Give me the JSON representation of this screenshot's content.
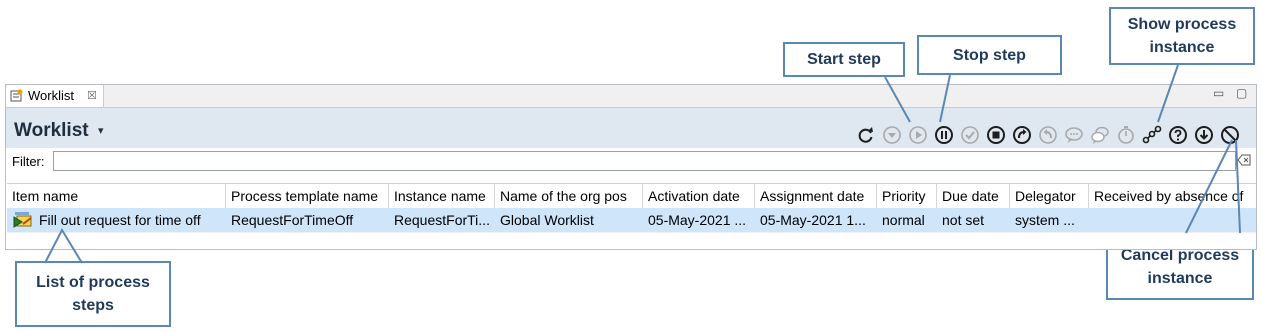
{
  "view": {
    "tab_label": "Worklist",
    "tab_close": "☒",
    "minimize_glyph": "▭",
    "maximize_glyph": "▢",
    "title": "Worklist",
    "title_caret": "▾"
  },
  "toolbar": {
    "buttons": [
      {
        "name": "refresh-icon",
        "enabled": true
      },
      {
        "name": "move-down-icon",
        "enabled": false
      },
      {
        "name": "start-step-icon",
        "enabled": false
      },
      {
        "name": "stop-step-icon",
        "enabled": true
      },
      {
        "name": "complete-step-icon",
        "enabled": false
      },
      {
        "name": "terminate-step-icon",
        "enabled": true
      },
      {
        "name": "forward-icon",
        "enabled": true
      },
      {
        "name": "return-icon",
        "enabled": false
      },
      {
        "name": "comment-icon",
        "enabled": false
      },
      {
        "name": "discussion-icon",
        "enabled": false
      },
      {
        "name": "timer-icon",
        "enabled": false
      },
      {
        "name": "show-process-instance-icon",
        "enabled": true
      },
      {
        "name": "help-icon",
        "enabled": true
      },
      {
        "name": "download-icon",
        "enabled": true
      },
      {
        "name": "cancel-process-instance-icon",
        "enabled": true
      }
    ]
  },
  "filter": {
    "label": "Filter:",
    "value": "",
    "placeholder": ""
  },
  "table": {
    "columns": [
      "Item name",
      "Process template name",
      "Instance name",
      "Name of the org pos",
      "Activation date",
      "Assignment date",
      "Priority",
      "Due date",
      "Delegator",
      "Received by absence of"
    ],
    "rows": [
      {
        "item_name": "Fill out request for time off",
        "process_template": "RequestForTimeOff",
        "instance_name": "RequestForTi...",
        "org_pos": "Global Worklist",
        "activation_date": "05-May-2021 ...",
        "assignment_date": "05-May-2021 1...",
        "priority": "normal",
        "due_date": "not set",
        "delegator": "system ...",
        "received_by": ""
      }
    ]
  },
  "callouts": {
    "start_step": "Start step",
    "stop_step": "Stop step",
    "show_process_instance_line1": "Show process",
    "show_process_instance_line2": "instance",
    "cancel_process_instance_line1": "Cancel process",
    "cancel_process_instance_line2": "instance",
    "list_of_steps_line1": "List of process",
    "list_of_steps_line2": "steps"
  },
  "colors": {
    "accent": "#1f3a5c",
    "callout_border": "#5b87b4",
    "header_bg": "#dfe7f0",
    "row_selected": "#cfe5fa",
    "icon_enabled": "#1e1e1e",
    "icon_disabled": "#a9a9a9"
  }
}
